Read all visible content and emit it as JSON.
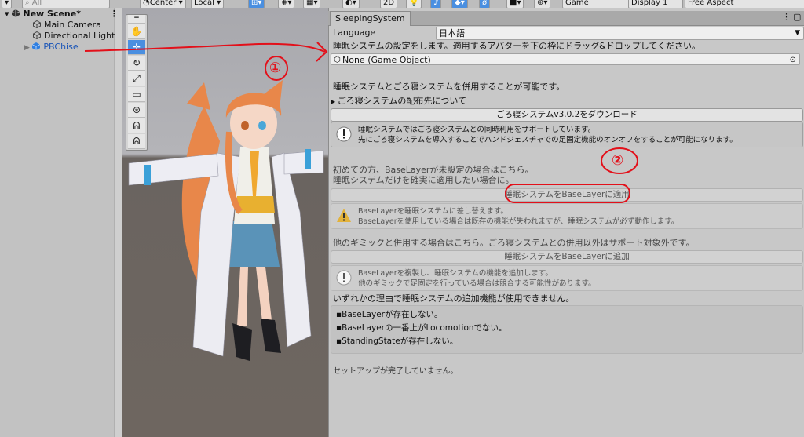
{
  "toolbar": {
    "search_placeholder": "All",
    "pivot": "Center",
    "space": "Local",
    "mode_2d": "2D",
    "game_label": "Game",
    "display": "Display 1",
    "aspect": "Free Aspect"
  },
  "hierarchy": {
    "scene_name": "New Scene*",
    "items": [
      "Main Camera",
      "Directional Light",
      "PBChise"
    ]
  },
  "inspector": {
    "tab_title": "SleepingSystem",
    "language_label": "Language",
    "language_value": "日本語",
    "description": "睡眠システムの設定をします。適用するアバターを下の枠にドラッグ&ドロップしてください。",
    "avatar_field": "None (Game Object)",
    "can_combine": "睡眠システムとごろ寝システムを併用することが可能です。",
    "foldout": "ごろ寝システムの配布先について",
    "download_button": "ごろ寝システムv3.0.2をダウンロード",
    "info1": [
      "睡眠システムではごろ寝システムとの同時利用をサポートしています。",
      "先にごろ寝システムを導入することでハンドジェスチャでの足固定機能のオンオフをすることが可能になります。"
    ],
    "first_time": "初めての方、BaseLayerが未設定の場合はこちら。",
    "only_apply": "睡眠システムだけを確実に適用したい場合に。",
    "apply_button": "睡眠システムをBaseLayerに適用",
    "warn": [
      "BaseLayerを睡眠システムに差し替えます。",
      "BaseLayerを使用している場合は既存の機能が失われますが、睡眠システムが必ず動作します。"
    ],
    "other_gimmick": "他のギミックと併用する場合はこちら。ごろ寝システムとの併用以外はサポート対象外です。",
    "add_button": "睡眠システムをBaseLayerに追加",
    "info2": [
      "BaseLayerを複製し、睡眠システムの機能を追加します。",
      "他のギミックで足固定を行っている場合は競合する可能性があります。"
    ],
    "cannot_use": "いずれかの理由で睡眠システムの追加機能が使用できません。",
    "reasons": [
      "BaseLayerが存在しない。",
      "BaseLayerの一番上がLocomotionでない。",
      "StandingStateが存在しない。"
    ],
    "setup_status": "セットアップが完了していません。"
  },
  "annotations": {
    "mark1": "①",
    "mark2": "②",
    "color": "#e3101a"
  }
}
